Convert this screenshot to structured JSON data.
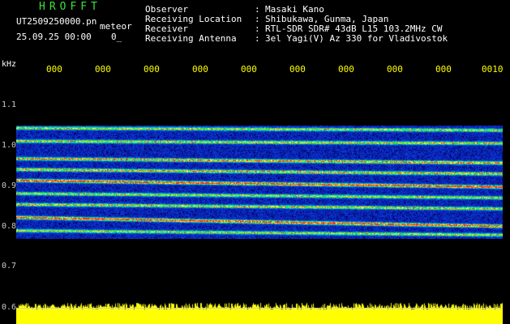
{
  "header": {
    "app_title": "HROFFT",
    "file_name": "UT2509250000.pn",
    "event_type": "meteor",
    "datetime": "25.09.25 00:00",
    "datetime_suffix": "0_",
    "fields": [
      {
        "label": "Observer",
        "value": "Masaki Kano"
      },
      {
        "label": "Receiving Location",
        "value": "Shibukawa, Gunma, Japan"
      },
      {
        "label": "Receiver",
        "value": "RTL-SDR SDR# 43dB L15 103.2MHz CW"
      },
      {
        "label": "Receiving Antenna",
        "value": "3el Yagi(V) Az 330 for Vladivostok"
      }
    ],
    "separator": ":"
  },
  "axes": {
    "y_unit": "kHz",
    "y_labels": [
      "1.1",
      "1.0",
      "0.9",
      "0.8",
      "0.7",
      "0.6"
    ],
    "time_labels": [
      "000",
      "000",
      "000",
      "000",
      "000",
      "000",
      "000",
      "000",
      "000",
      "0010"
    ]
  },
  "colors": {
    "title": "#38e238",
    "tick": "#ffff00",
    "power": "#ffff00",
    "text": "#ffffff",
    "spectro_noise": "#1a2aa8",
    "spectro_line": "#ff3030"
  },
  "spectrogram": {
    "freq_range_khz": [
      0.78,
      1.04
    ],
    "bands": [
      {
        "f0": 1.035,
        "f1": 1.03,
        "strength": 0.7
      },
      {
        "f0": 1.005,
        "f1": 1.0,
        "strength": 0.75
      },
      {
        "f0": 0.965,
        "f1": 0.955,
        "strength": 0.85
      },
      {
        "f0": 0.94,
        "f1": 0.93,
        "strength": 0.8
      },
      {
        "f0": 0.915,
        "f1": 0.9,
        "strength": 1.0
      },
      {
        "f0": 0.885,
        "f1": 0.875,
        "strength": 0.7
      },
      {
        "f0": 0.86,
        "f1": 0.85,
        "strength": 0.75
      },
      {
        "f0": 0.83,
        "f1": 0.81,
        "strength": 1.0
      },
      {
        "f0": 0.8,
        "f1": 0.79,
        "strength": 0.7
      }
    ]
  }
}
